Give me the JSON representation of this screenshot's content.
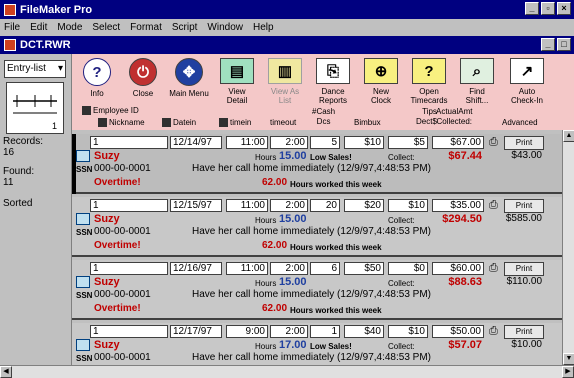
{
  "app": {
    "title": "FileMaker Pro",
    "doc_title": "DCT.RWR"
  },
  "menu": [
    "File",
    "Edit",
    "Mode",
    "Select",
    "Format",
    "Script",
    "Window",
    "Help"
  ],
  "status": {
    "layout": "Entry-list",
    "page_number": "1",
    "records_label": "Records:",
    "records_value": "16",
    "found_label": "Found:",
    "found_value": "11",
    "sorted_label": "Sorted"
  },
  "toolbar": {
    "buttons": [
      {
        "label": "Info",
        "icon": "?"
      },
      {
        "label": "Close",
        "icon": "⏻"
      },
      {
        "label": "Main Menu",
        "icon": "✥"
      },
      {
        "label": "View\nDetail",
        "icon": "▤"
      },
      {
        "label": "View As\nList",
        "icon": "▥"
      },
      {
        "label": "Dance\nReports",
        "icon": "⎘"
      },
      {
        "label": "New\nClock",
        "icon": "⊕"
      },
      {
        "label": "Open\nTimecards",
        "icon": "?"
      },
      {
        "label": "Find\nShift...",
        "icon": "⌕"
      },
      {
        "label": "Auto\nCheck-In",
        "icon": "↗"
      }
    ],
    "headers": {
      "employee_id": "Employee ID",
      "nickname": "Nickname",
      "datein": "Datein",
      "timein": "timein",
      "timeout": "timeout",
      "cash": "#Cash\nDcs",
      "bimbux": "Bimbux",
      "tips": "Tips\nDect$",
      "actual": "ActualAmt\nCollected:",
      "advanced": "Advanced"
    }
  },
  "records": [
    {
      "id": "1",
      "date": "12/14/97",
      "timein": "11:00",
      "timeout": "2:00",
      "cash": "5",
      "bimbux": "$10",
      "tips": "$5",
      "actual": "$67.00",
      "name": "Suzy",
      "hours_label": "Hours",
      "hours": "15.00",
      "low_sales": "Low Sales!",
      "collect_label": "Collect:",
      "collect": "$67.44",
      "advanced": "$43.00",
      "ssn_label": "SSN",
      "ssn": "000-00-0001",
      "note": "Have her call home immediately (12/9/97,4:48:53 PM)",
      "overtime": "Overtime!",
      "week_hours": "62.00",
      "week_label": "Hours worked this week",
      "print": "Print"
    },
    {
      "id": "1",
      "date": "12/15/97",
      "timein": "11:00",
      "timeout": "2:00",
      "cash": "20",
      "bimbux": "$20",
      "tips": "$10",
      "actual": "$35.00",
      "name": "Suzy",
      "hours_label": "Hours",
      "hours": "15.00",
      "low_sales": "",
      "collect_label": "Collect:",
      "collect": "$294.50",
      "advanced": "$585.00",
      "ssn_label": "SSN",
      "ssn": "000-00-0001",
      "note": "Have her call home immediately (12/9/97,4:48:53 PM)",
      "overtime": "Overtime!",
      "week_hours": "62.00",
      "week_label": "Hours worked this week",
      "print": "Print"
    },
    {
      "id": "1",
      "date": "12/16/97",
      "timein": "11:00",
      "timeout": "2:00",
      "cash": "6",
      "bimbux": "$50",
      "tips": "$0",
      "actual": "$60.00",
      "name": "Suzy",
      "hours_label": "Hours",
      "hours": "15.00",
      "low_sales": "",
      "collect_label": "Collect:",
      "collect": "$88.63",
      "advanced": "$110.00",
      "ssn_label": "SSN",
      "ssn": "000-00-0001",
      "note": "Have her call home immediately (12/9/97,4:48:53 PM)",
      "overtime": "Overtime!",
      "week_hours": "62.00",
      "week_label": "Hours worked this week",
      "print": "Print"
    },
    {
      "id": "1",
      "date": "12/17/97",
      "timein": "9:00",
      "timeout": "2:00",
      "cash": "1",
      "bimbux": "$40",
      "tips": "$10",
      "actual": "$50.00",
      "name": "Suzy",
      "hours_label": "Hours",
      "hours": "17.00",
      "low_sales": "Low Sales!",
      "collect_label": "Collect:",
      "collect": "$57.07",
      "advanced": "$10.00",
      "ssn_label": "SSN",
      "ssn": "000-00-0001",
      "note": "Have her call home immediately (12/9/97,4:48:53 PM)",
      "overtime": "",
      "week_hours": "",
      "week_label": "",
      "print": "Print"
    }
  ]
}
